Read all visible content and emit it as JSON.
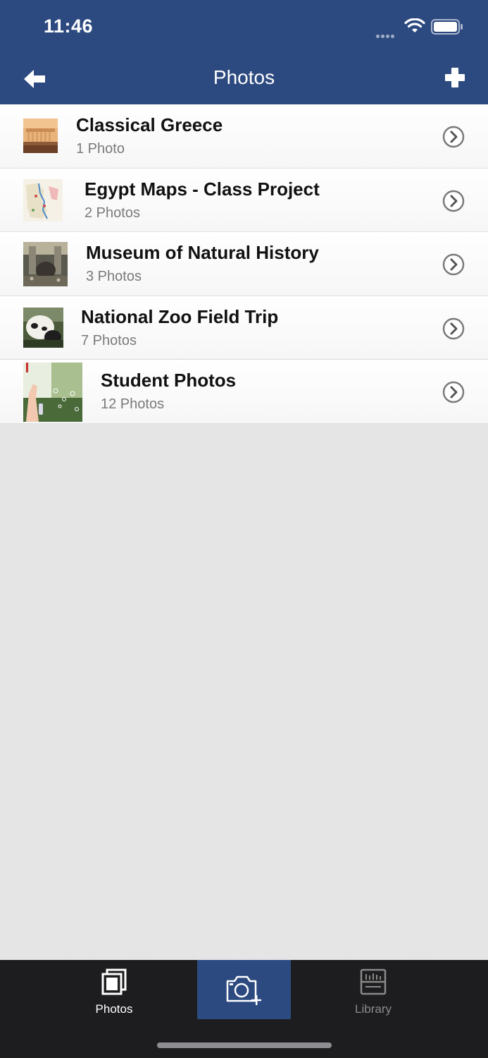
{
  "status": {
    "time": "11:46"
  },
  "nav": {
    "title": "Photos"
  },
  "albums": [
    {
      "title": "Classical Greece",
      "count": "1 Photo"
    },
    {
      "title": "Egypt Maps - Class Project",
      "count": "2 Photos"
    },
    {
      "title": "Museum of Natural History",
      "count": "3 Photos"
    },
    {
      "title": "National Zoo Field Trip",
      "count": "7 Photos"
    },
    {
      "title": "Student Photos",
      "count": "12 Photos"
    }
  ],
  "tabs": {
    "photos": {
      "label": "Photos",
      "icon": "photos-icon"
    },
    "camera": {
      "icon": "camera-add-icon"
    },
    "library": {
      "label": "Library",
      "icon": "library-icon"
    }
  },
  "colors": {
    "header": "#2d4a80",
    "tab_bar": "#1d1d1f",
    "active_tab": "#2d4a80"
  }
}
